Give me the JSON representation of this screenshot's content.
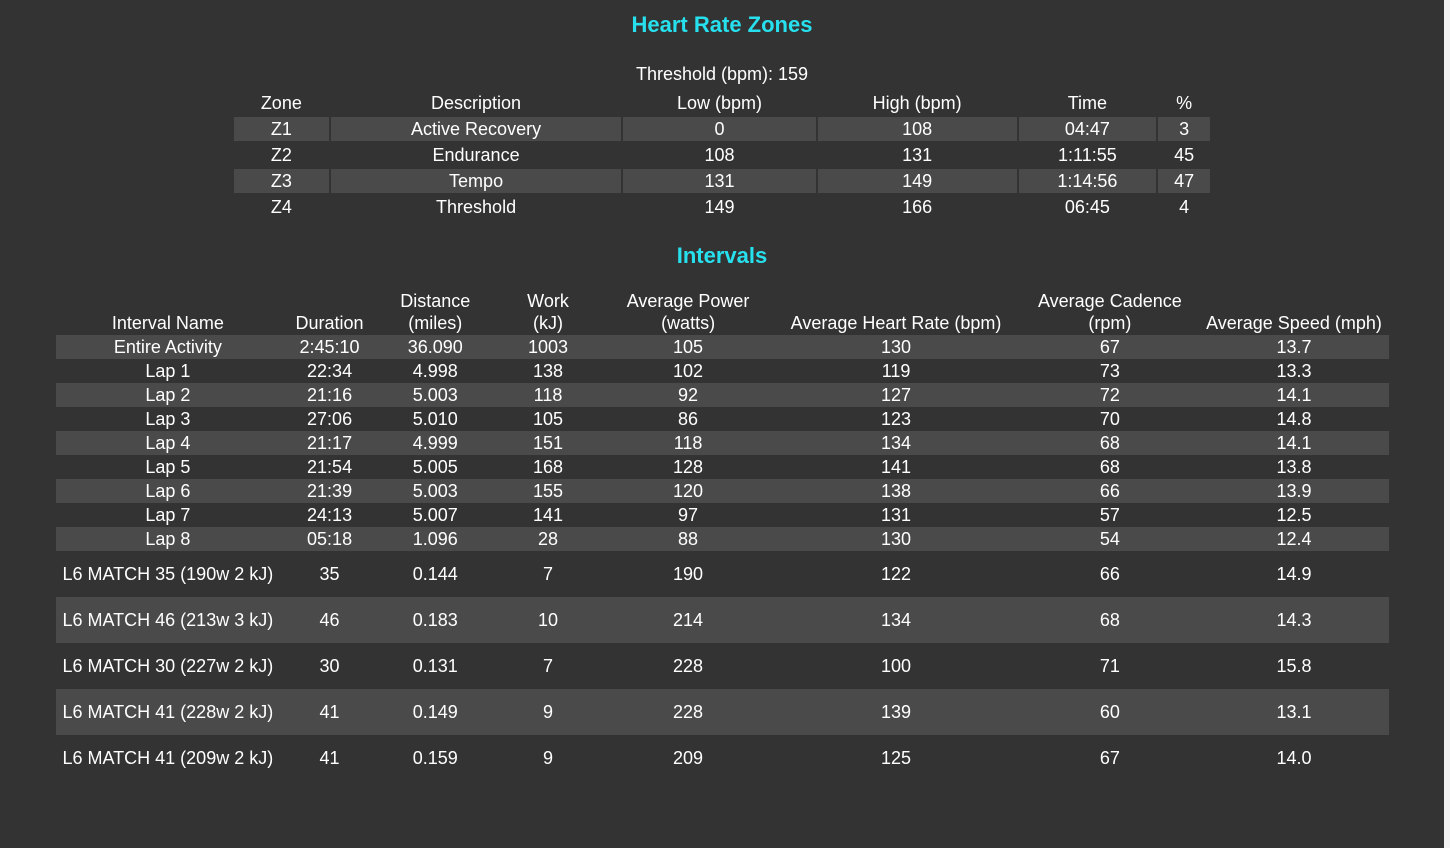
{
  "heart_rate": {
    "title": "Heart Rate Zones",
    "threshold_label": "Threshold (bpm): 159",
    "columns": [
      "Zone",
      "Description",
      "Low (bpm)",
      "High (bpm)",
      "Time",
      "%"
    ],
    "rows": [
      [
        "Z1",
        "Active Recovery",
        "0",
        "108",
        "04:47",
        "3"
      ],
      [
        "Z2",
        "Endurance",
        "108",
        "131",
        "1:11:55",
        "45"
      ],
      [
        "Z3",
        "Tempo",
        "131",
        "149",
        "1:14:56",
        "47"
      ],
      [
        "Z4",
        "Threshold",
        "149",
        "166",
        "06:45",
        "4"
      ]
    ]
  },
  "intervals": {
    "title": "Intervals",
    "columns": [
      "Interval Name",
      "Duration",
      "Distance (miles)",
      "Work (kJ)",
      "Average Power (watts)",
      "Average Heart Rate (bpm)",
      "Average Cadence (rpm)",
      "Average Speed (mph)"
    ],
    "rows": [
      [
        "Entire Activity",
        "2:45:10",
        "36.090",
        "1003",
        "105",
        "130",
        "67",
        "13.7"
      ],
      [
        "Lap 1",
        "22:34",
        "4.998",
        "138",
        "102",
        "119",
        "73",
        "13.3"
      ],
      [
        "Lap 2",
        "21:16",
        "5.003",
        "118",
        "92",
        "127",
        "72",
        "14.1"
      ],
      [
        "Lap 3",
        "27:06",
        "5.010",
        "105",
        "86",
        "123",
        "70",
        "14.8"
      ],
      [
        "Lap 4",
        "21:17",
        "4.999",
        "151",
        "118",
        "134",
        "68",
        "14.1"
      ],
      [
        "Lap 5",
        "21:54",
        "5.005",
        "168",
        "128",
        "141",
        "68",
        "13.8"
      ],
      [
        "Lap 6",
        "21:39",
        "5.003",
        "155",
        "120",
        "138",
        "66",
        "13.9"
      ],
      [
        "Lap 7",
        "24:13",
        "5.007",
        "141",
        "97",
        "131",
        "57",
        "12.5"
      ],
      [
        "Lap 8",
        "05:18",
        "1.096",
        "28",
        "88",
        "130",
        "54",
        "12.4"
      ],
      [
        "L6 MATCH 35 (190w 2 kJ)",
        "35",
        "0.144",
        "7",
        "190",
        "122",
        "66",
        "14.9"
      ],
      [
        "L6 MATCH 46 (213w 3 kJ)",
        "46",
        "0.183",
        "10",
        "214",
        "134",
        "68",
        "14.3"
      ],
      [
        "L6 MATCH 30 (227w 2 kJ)",
        "30",
        "0.131",
        "7",
        "228",
        "100",
        "71",
        "15.8"
      ],
      [
        "L6 MATCH 41 (228w 2 kJ)",
        "41",
        "0.149",
        "9",
        "228",
        "139",
        "60",
        "13.1"
      ],
      [
        "L6 MATCH 41 (209w 2 kJ)",
        "41",
        "0.159",
        "9",
        "209",
        "125",
        "67",
        "14.0"
      ]
    ]
  },
  "colors": {
    "background": "#333333",
    "stripe": "#4a4a4a",
    "heading": "#27e0ee",
    "text": "#ffffff"
  }
}
